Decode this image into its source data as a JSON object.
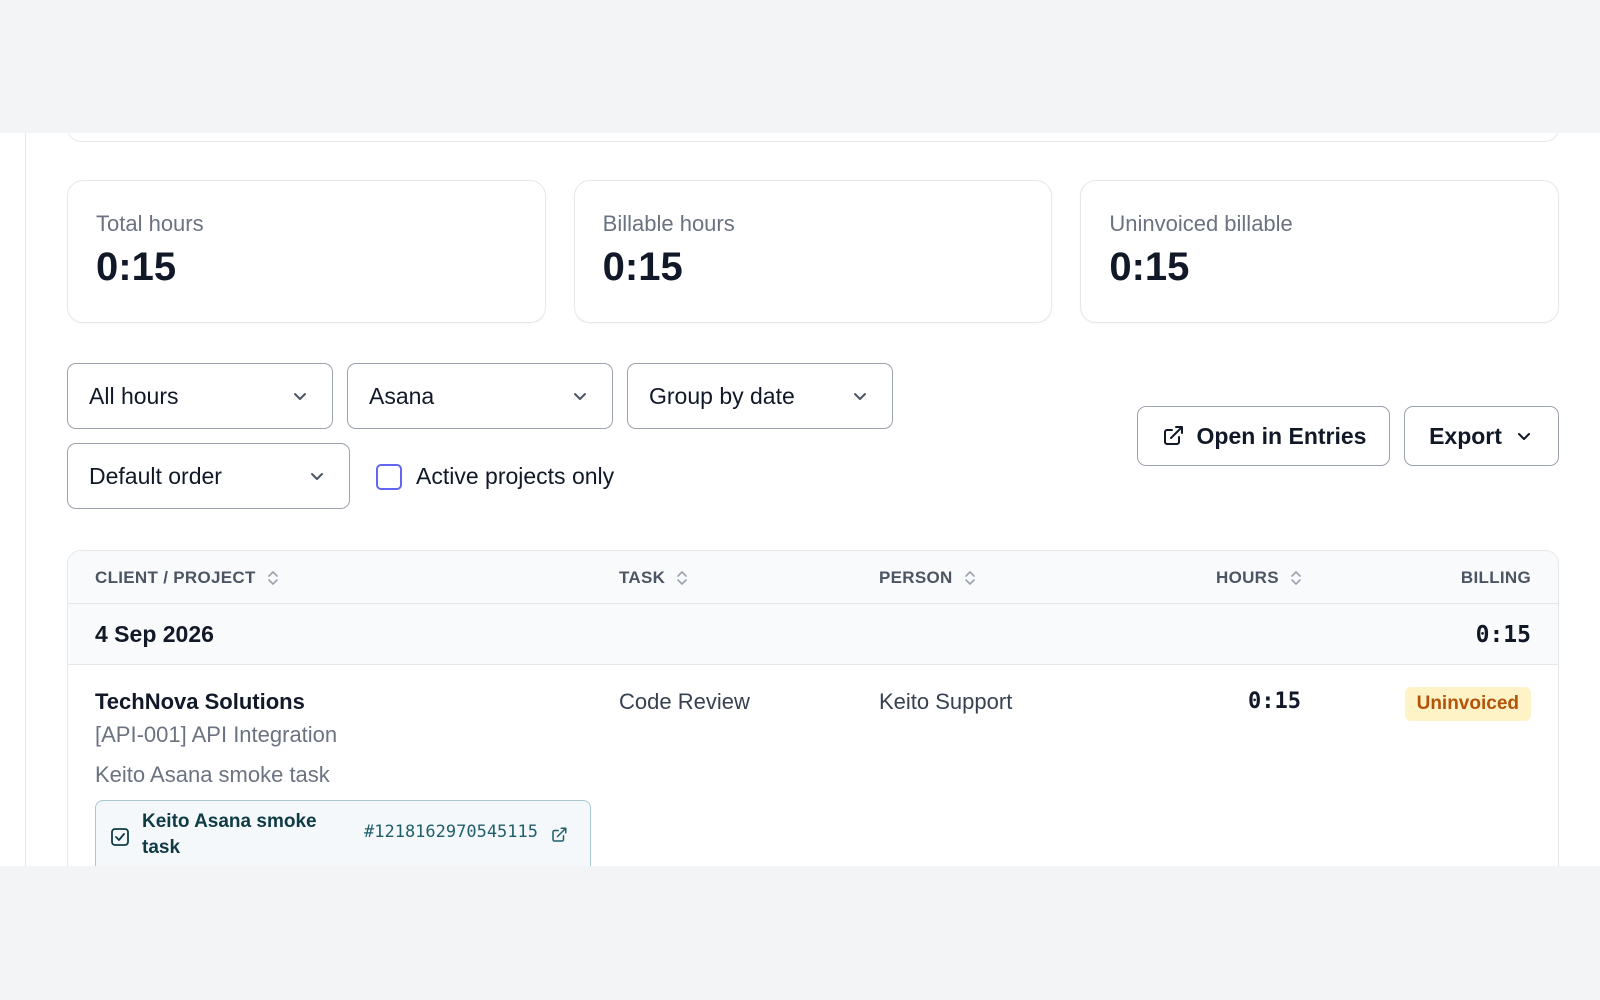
{
  "stats": [
    {
      "label": "Total hours",
      "value": "0:15"
    },
    {
      "label": "Billable hours",
      "value": "0:15"
    },
    {
      "label": "Uninvoiced billable",
      "value": "0:15"
    }
  ],
  "filters": {
    "hours_filter": "All hours",
    "integration_filter": "Asana",
    "group_by": "Group by date",
    "order": "Default order",
    "active_only_label": "Active projects only"
  },
  "actions": {
    "open_in_entries": "Open in Entries",
    "export": "Export"
  },
  "table": {
    "columns": [
      "CLIENT / PROJECT",
      "TASK",
      "PERSON",
      "HOURS",
      "BILLING"
    ],
    "group": {
      "date": "4 Sep 2026",
      "total": "0:15"
    },
    "rows": [
      {
        "client": "TechNova Solutions",
        "project": "[API-001] API Integration",
        "description": "Keito Asana smoke task",
        "task": "Code Review",
        "person": "Keito Support",
        "hours": "0:15",
        "billing": "Uninvoiced",
        "asana": {
          "title": "Keito Asana smoke task",
          "id": "#1218162970545115"
        }
      }
    ]
  },
  "colors": {
    "accent": "#6366f1",
    "badge_bg": "#fef3c7",
    "badge_text": "#b45309"
  }
}
